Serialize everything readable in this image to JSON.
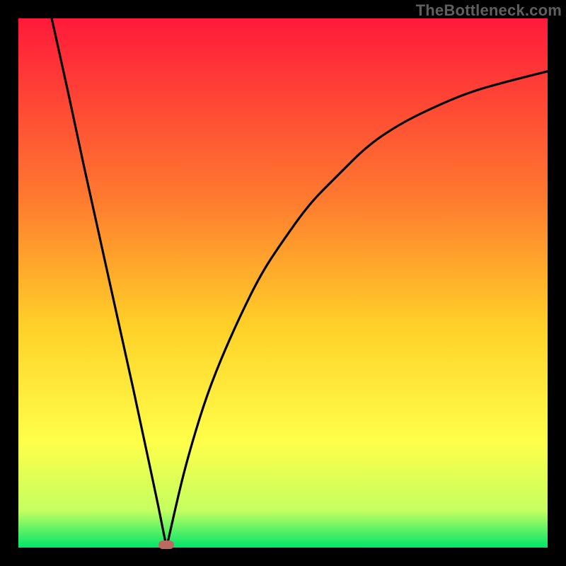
{
  "watermark": "TheBottleneck.com",
  "gradient": {
    "top": "#ff1a3a",
    "mid_upper": "#ff7a2f",
    "mid": "#ffd028",
    "mid_lower": "#ffff4a",
    "green_upper": "#c4ff60",
    "green_lower": "#00e56a"
  },
  "curve_color": "#000000",
  "marker_color": "#bb6a62",
  "chart_data": {
    "type": "line",
    "title": "",
    "xlabel": "",
    "ylabel": "",
    "xlim": [
      0,
      100
    ],
    "ylim": [
      0,
      100
    ],
    "min_point_x": 28,
    "marker": {
      "x": 28,
      "y": 0
    },
    "left_branch": [
      {
        "x": 6.3,
        "y": 100
      },
      {
        "x": 9.4,
        "y": 86
      },
      {
        "x": 12.4,
        "y": 72
      },
      {
        "x": 15.5,
        "y": 58
      },
      {
        "x": 18.6,
        "y": 44
      },
      {
        "x": 21.7,
        "y": 30
      },
      {
        "x": 24.7,
        "y": 16
      },
      {
        "x": 26.4,
        "y": 8
      },
      {
        "x": 28.0,
        "y": 0
      }
    ],
    "right_branch": [
      {
        "x": 28.0,
        "y": 0
      },
      {
        "x": 30.0,
        "y": 9
      },
      {
        "x": 32.0,
        "y": 17
      },
      {
        "x": 35.0,
        "y": 27
      },
      {
        "x": 38.0,
        "y": 35
      },
      {
        "x": 42.0,
        "y": 44
      },
      {
        "x": 46.0,
        "y": 52
      },
      {
        "x": 50.0,
        "y": 58
      },
      {
        "x": 55.0,
        "y": 65
      },
      {
        "x": 60.0,
        "y": 70
      },
      {
        "x": 66.0,
        "y": 76
      },
      {
        "x": 72.0,
        "y": 80
      },
      {
        "x": 78.0,
        "y": 83
      },
      {
        "x": 85.0,
        "y": 86
      },
      {
        "x": 92.0,
        "y": 88
      },
      {
        "x": 100.0,
        "y": 90
      }
    ]
  }
}
